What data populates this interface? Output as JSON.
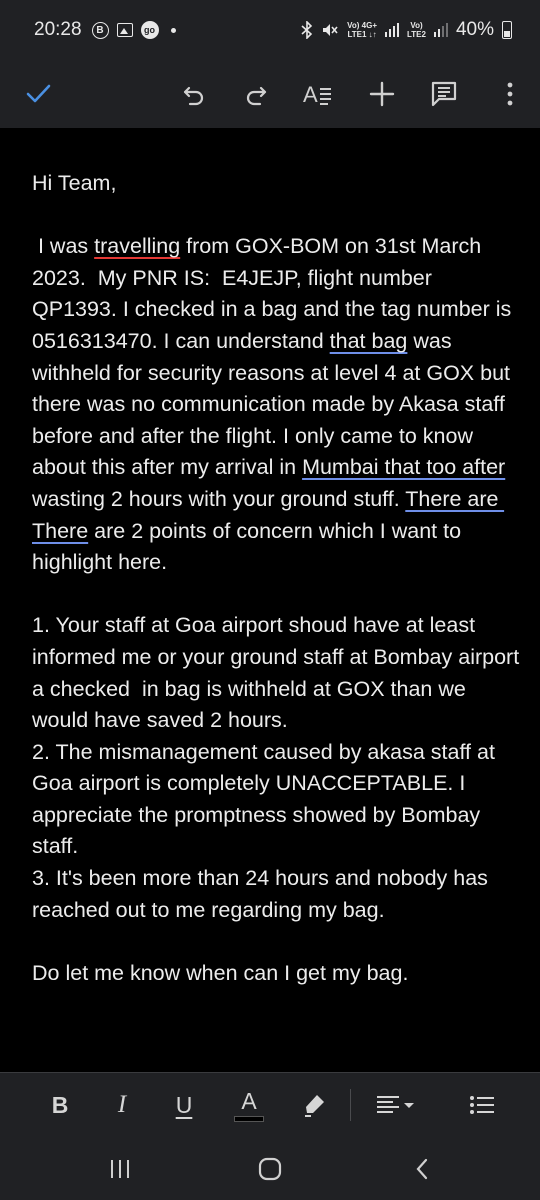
{
  "status_bar": {
    "time": "20:28",
    "notification_icons": [
      "b-icon",
      "image-icon",
      "go-icon",
      "dot"
    ],
    "network_labels": [
      "Vo) 4G+ LTE1",
      "Vo) LTE2"
    ],
    "battery": "40%",
    "battery_level": 0.4
  },
  "toolbar": {
    "icons": [
      "check-icon",
      "undo-icon",
      "redo-icon",
      "text-format-icon",
      "add-icon",
      "comment-icon",
      "more-vert-icon"
    ],
    "accent_color": "#4a90e2"
  },
  "document": {
    "greeting": "Hi Team,",
    "para1_a": " I was ",
    "para1_travelling": "travelling",
    "para1_b": " from GOX-BOM on 31st March 2023.  My PNR IS:  E4JEJP, flight number QP1393. I checked in a bag and the tag number is 0516313470. I can understand ",
    "para1_thatbag": "that bag",
    "para1_c": " was withheld for security reasons at level 4 at GOX but there was no communication made by Akasa staff before and after the flight. I only came to know about this after my arrival in ",
    "para1_mumbai": "Mumbai that too after",
    "para1_d": " wasting 2 hours with your ground stuff. ",
    "para1_thereare": "There are There",
    "para1_e": " are 2 points of concern which I want to highlight here.",
    "point1": "1. Your staff at Goa airport shoud have at least informed me or your ground staff at Bombay airport a checked  in bag is withheld at GOX than we would have saved 2 hours.",
    "point2": "2. The mismanagement caused by akasa staff at Goa airport is completely UNACCEPTABLE. I appreciate the promptness showed by Bombay staff.",
    "point3": "3. It's been more than 24 hours and nobody has reached out to me regarding my bag.",
    "closing": "Do let me know when can I get my bag."
  },
  "format_bar": {
    "bold_label": "B",
    "italic_label": "I",
    "underline_label": "U",
    "text_color_label": "A",
    "icons": [
      "highlight-icon",
      "align-icon",
      "list-icon"
    ]
  },
  "nav_bar": {
    "icons": [
      "recent-apps-icon",
      "home-icon",
      "back-icon"
    ]
  }
}
